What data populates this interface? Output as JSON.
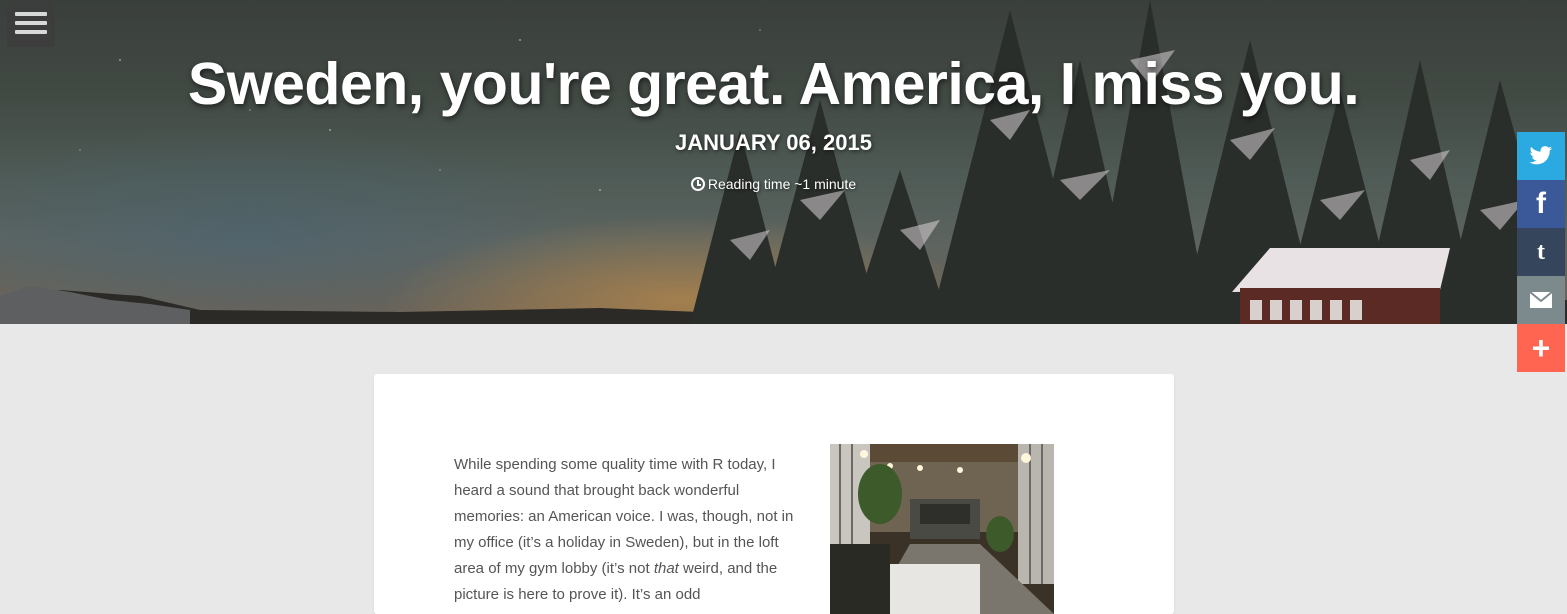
{
  "menu": {
    "icon": "hamburger-icon"
  },
  "header": {
    "title": "Sweden, you're great. America, I miss you.",
    "date": "JANUARY 06, 2015",
    "reading_time": "Reading time ~1 minute",
    "reading_icon": "clock-icon"
  },
  "share": [
    {
      "name": "twitter",
      "icon": "twitter-icon",
      "color": "#2ba9e1"
    },
    {
      "name": "facebook",
      "icon": "facebook-icon",
      "color": "#3b5998"
    },
    {
      "name": "tumblr",
      "icon": "tumblr-icon",
      "color": "#35465c"
    },
    {
      "name": "email",
      "icon": "email-icon",
      "color": "#7d8a8d"
    },
    {
      "name": "more",
      "icon": "plus-icon",
      "color": "#ff6550"
    }
  ],
  "post": {
    "p1_part1": "While spending some quality time with R today, I heard a sound that brought back wonderful memories: an American voice. I was, though, not in my office (it’s a holiday in Sweden), but in the loft area of my gym lobby (it’s not ",
    "p1_em": "that",
    "p1_part2": " weird, and the picture is here to prove it). It’s an odd"
  }
}
